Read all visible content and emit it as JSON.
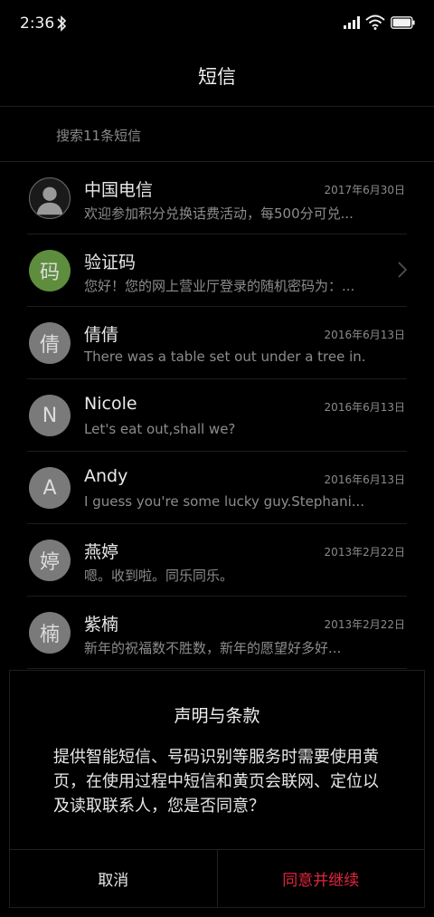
{
  "status_bar": {
    "time": "2:36"
  },
  "header": {
    "title": "短信"
  },
  "search": {
    "placeholder": "搜索11条短信"
  },
  "conversations": [
    {
      "name": "中国电信",
      "date": "2017年6月30日",
      "snippet": "欢迎参加积分兑换话费活动，每500分可兑...",
      "avatar_type": "person-icon"
    },
    {
      "name": "验证码",
      "date": "",
      "snippet": "您好！您的网上营业厅登录的随机密码为：...",
      "avatar_text": "码",
      "avatar_color": "#5e8d3e"
    },
    {
      "name": "倩倩",
      "date": "2016年6月13日",
      "snippet": "There was a table set out under a tree in...",
      "avatar_text": "倩"
    },
    {
      "name": "Nicole",
      "date": "2016年6月13日",
      "snippet": "Let's eat out,shall we?",
      "avatar_text": "N"
    },
    {
      "name": "Andy",
      "date": "2016年6月13日",
      "snippet": "I guess you're some lucky guy.Stephani...",
      "avatar_text": "A"
    },
    {
      "name": "燕婷",
      "date": "2013年2月22日",
      "snippet": "嗯。收到啦。同乐同乐。",
      "avatar_text": "婷"
    },
    {
      "name": "紫楠",
      "date": "2013年2月22日",
      "snippet": "新年的祝福数不胜数，新年的愿望好多好...",
      "avatar_text": "楠"
    }
  ],
  "dialog": {
    "title": "声明与条款",
    "body": "提供智能短信、号码识别等服务时需要使用黄页，在使用过程中短信和黄页会联网、定位以及读取联系人，您是否同意？",
    "cancel_label": "取消",
    "agree_label": "同意并继续",
    "agree_color": "#e0263c"
  }
}
